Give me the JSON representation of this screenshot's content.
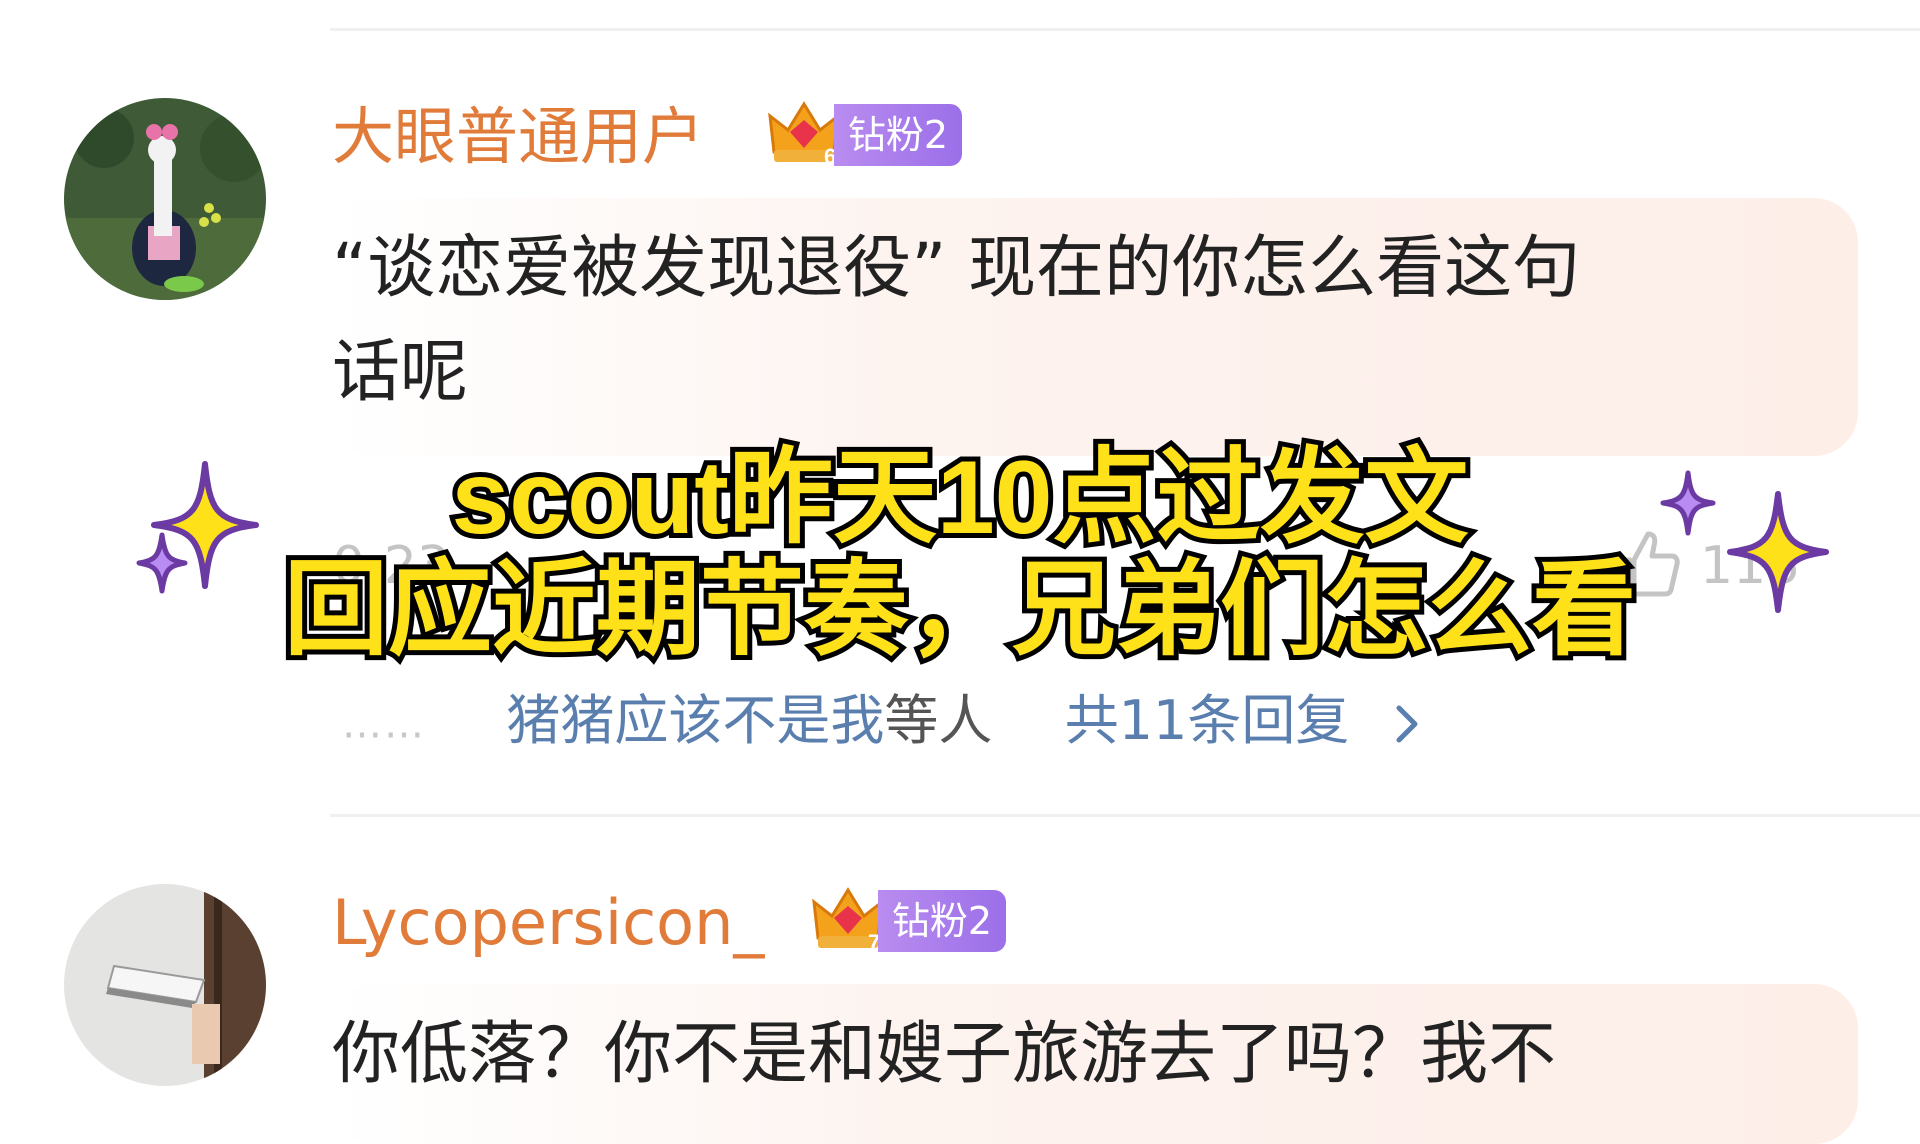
{
  "comments": [
    {
      "username": "大眼普通用户",
      "crown_level": "6",
      "badge": "钻粉2",
      "text_lines": [
        "“谈恋爱被发现退役” 现在的你怎么看这句",
        "话呢"
      ],
      "meta_time": "0-23",
      "like_count": "116",
      "reply": {
        "user": "猪猪应该不是我",
        "text": "等人",
        "count_label": "共11条回复",
        "dots": "……"
      }
    },
    {
      "username": "Lycopersicon_",
      "crown_level": "7",
      "badge": "钻粉2",
      "text_lines": [
        "你低落？你不是和嫂子旅游去了吗？我不"
      ]
    }
  ],
  "overlay": {
    "line1": "scout昨天10点过发文",
    "line2": "回应近期节奏，兄弟们怎么看"
  },
  "colors": {
    "username": "#e07b39",
    "badge": "#a97bec",
    "reply_link": "#5a7fae",
    "overlay_fill": "#ffe11a",
    "overlay_stroke": "#000000"
  }
}
